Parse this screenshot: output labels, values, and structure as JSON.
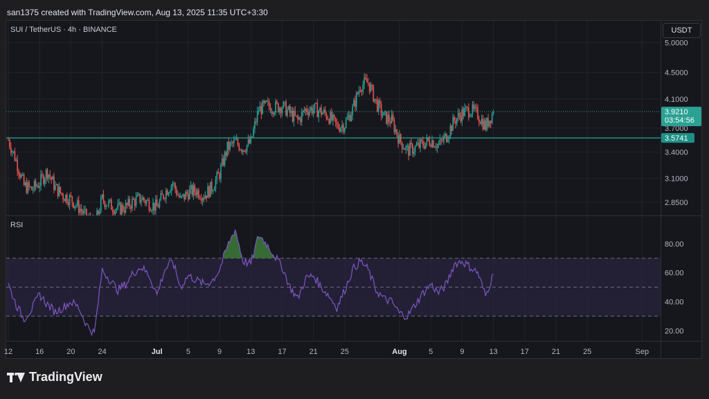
{
  "header": {
    "attribution": "san1375 created with TradingView.com, Aug 13, 2025 11:35 UTC+3:30"
  },
  "brand": {
    "name": "TradingView"
  },
  "chart_data": [
    {
      "type": "candlestick",
      "title": "SUI / TetherUS · 4h · BINANCE",
      "currency_button": "USDT",
      "yscale": "log",
      "ylim": [
        2.72,
        5.4
      ],
      "yticks": [
        "5.0000",
        "4.5000",
        "4.1000",
        "3.7000",
        "3.4000",
        "3.1000",
        "2.8500"
      ],
      "last_price": {
        "value": 3.921,
        "label": "3.9210",
        "countdown": "03:54:56"
      },
      "horizontal_line": {
        "value": 3.5741,
        "label": "3.5741"
      },
      "x_axis": {
        "ticks": [
          "12",
          "16",
          "20",
          "24",
          "Jul",
          "5",
          "9",
          "13",
          "17",
          "21",
          "25",
          "Aug",
          "5",
          "9",
          "13",
          "17",
          "21",
          "25",
          "Sep"
        ],
        "bold_ticks": [
          "Jul",
          "Aug"
        ]
      },
      "close_path": [
        [
          "Jun 12",
          3.55
        ],
        [
          "Jun 13",
          3.3
        ],
        [
          "Jun 14",
          3.02
        ],
        [
          "Jun 15",
          2.98
        ],
        [
          "Jun 16",
          3.05
        ],
        [
          "Jun 17",
          3.18
        ],
        [
          "Jun 18",
          3.0
        ],
        [
          "Jun 19",
          2.92
        ],
        [
          "Jun 20",
          2.88
        ],
        [
          "Jun 21",
          2.8
        ],
        [
          "Jun 22",
          2.7
        ],
        [
          "Jun 23",
          2.62
        ],
        [
          "Jun 24",
          2.88
        ],
        [
          "Jun 25",
          2.82
        ],
        [
          "Jun 26",
          2.78
        ],
        [
          "Jun 27",
          2.8
        ],
        [
          "Jun 28",
          2.86
        ],
        [
          "Jun 29",
          2.89
        ],
        [
          "Jun 30",
          2.84
        ],
        [
          "Jul 1",
          2.8
        ],
        [
          "Jul 2",
          2.95
        ],
        [
          "Jul 3",
          3.05
        ],
        [
          "Jul 4",
          2.87
        ],
        [
          "Jul 5",
          2.95
        ],
        [
          "Jul 6",
          2.97
        ],
        [
          "Jul 7",
          2.92
        ],
        [
          "Jul 8",
          3.0
        ],
        [
          "Jul 9",
          3.15
        ],
        [
          "Jul 10",
          3.45
        ],
        [
          "Jul 11",
          3.52
        ],
        [
          "Jul 12",
          3.45
        ],
        [
          "Jul 13",
          3.52
        ],
        [
          "Jul 14",
          3.95
        ],
        [
          "Jul 15",
          4.0
        ],
        [
          "Jul 16",
          3.98
        ],
        [
          "Jul 17",
          4.0
        ],
        [
          "Jul 18",
          3.9
        ],
        [
          "Jul 19",
          3.8
        ],
        [
          "Jul 20",
          3.95
        ],
        [
          "Jul 21",
          3.96
        ],
        [
          "Jul 22",
          3.92
        ],
        [
          "Jul 23",
          3.85
        ],
        [
          "Jul 24",
          3.72
        ],
        [
          "Jul 25",
          3.75
        ],
        [
          "Jul 26",
          3.95
        ],
        [
          "Jul 27",
          4.3
        ],
        [
          "Jul 28",
          4.35
        ],
        [
          "Jul 29",
          4.05
        ],
        [
          "Jul 30",
          3.85
        ],
        [
          "Jul 31",
          3.8
        ],
        [
          "Aug 1",
          3.55
        ],
        [
          "Aug 2",
          3.42
        ],
        [
          "Aug 3",
          3.45
        ],
        [
          "Aug 4",
          3.5
        ],
        [
          "Aug 5",
          3.55
        ],
        [
          "Aug 6",
          3.48
        ],
        [
          "Aug 7",
          3.6
        ],
        [
          "Aug 8",
          3.8
        ],
        [
          "Aug 9",
          3.9
        ],
        [
          "Aug 10",
          3.95
        ],
        [
          "Aug 11",
          3.88
        ],
        [
          "Aug 12",
          3.72
        ],
        [
          "Aug 13",
          3.921
        ]
      ]
    },
    {
      "type": "line",
      "title": "RSI",
      "ylim": [
        13,
        99
      ],
      "yticks": [
        "80.00",
        "60.00",
        "40.00",
        "20.00"
      ],
      "band": {
        "upper": 70,
        "middle": 50,
        "lower": 30
      },
      "series": [
        {
          "values_by_day": [
            [
              "Jun 12",
              52
            ],
            [
              "Jun 13",
              38
            ],
            [
              "Jun 14",
              28
            ],
            [
              "Jun 15",
              35
            ],
            [
              "Jun 16",
              45
            ],
            [
              "Jun 17",
              38
            ],
            [
              "Jun 18",
              33
            ],
            [
              "Jun 19",
              36
            ],
            [
              "Jun 20",
              40
            ],
            [
              "Jun 21",
              36
            ],
            [
              "Jun 22",
              24
            ],
            [
              "Jun 23",
              18
            ],
            [
              "Jun 24",
              62
            ],
            [
              "Jun 25",
              55
            ],
            [
              "Jun 26",
              48
            ],
            [
              "Jun 27",
              52
            ],
            [
              "Jun 28",
              60
            ],
            [
              "Jun 29",
              64
            ],
            [
              "Jun 30",
              58
            ],
            [
              "Jul 1",
              45
            ],
            [
              "Jul 2",
              62
            ],
            [
              "Jul 3",
              68
            ],
            [
              "Jul 4",
              50
            ],
            [
              "Jul 5",
              58
            ],
            [
              "Jul 6",
              55
            ],
            [
              "Jul 7",
              52
            ],
            [
              "Jul 8",
              54
            ],
            [
              "Jul 9",
              62
            ],
            [
              "Jul 10",
              78
            ],
            [
              "Jul 11",
              90
            ],
            [
              "Jul 12",
              68
            ],
            [
              "Jul 13",
              66
            ],
            [
              "Jul 14",
              86
            ],
            [
              "Jul 15",
              80
            ],
            [
              "Jul 16",
              72
            ],
            [
              "Jul 17",
              64
            ],
            [
              "Jul 18",
              50
            ],
            [
              "Jul 19",
              42
            ],
            [
              "Jul 20",
              56
            ],
            [
              "Jul 21",
              58
            ],
            [
              "Jul 22",
              50
            ],
            [
              "Jul 23",
              44
            ],
            [
              "Jul 24",
              36
            ],
            [
              "Jul 25",
              48
            ],
            [
              "Jul 26",
              62
            ],
            [
              "Jul 27",
              68
            ],
            [
              "Jul 28",
              62
            ],
            [
              "Jul 29",
              48
            ],
            [
              "Jul 30",
              42
            ],
            [
              "Jul 31",
              40
            ],
            [
              "Aug 1",
              32
            ],
            [
              "Aug 2",
              30
            ],
            [
              "Aug 3",
              38
            ],
            [
              "Aug 4",
              46
            ],
            [
              "Aug 5",
              52
            ],
            [
              "Aug 6",
              46
            ],
            [
              "Aug 7",
              52
            ],
            [
              "Aug 8",
              66
            ],
            [
              "Aug 9",
              68
            ],
            [
              "Aug 10",
              64
            ],
            [
              "Aug 11",
              60
            ],
            [
              "Aug 12",
              44
            ],
            [
              "Aug 13",
              59
            ]
          ]
        }
      ]
    }
  ],
  "colors": {
    "up": "#26a69a",
    "down": "#ef5350",
    "rsi_line": "#7e57c2",
    "rsi_band": "#2a2542",
    "overbought_fill": "#3d7a3a",
    "price_label": "#2ba193",
    "line_label": "#1e8f87",
    "axis_text": "#b2b5be"
  }
}
